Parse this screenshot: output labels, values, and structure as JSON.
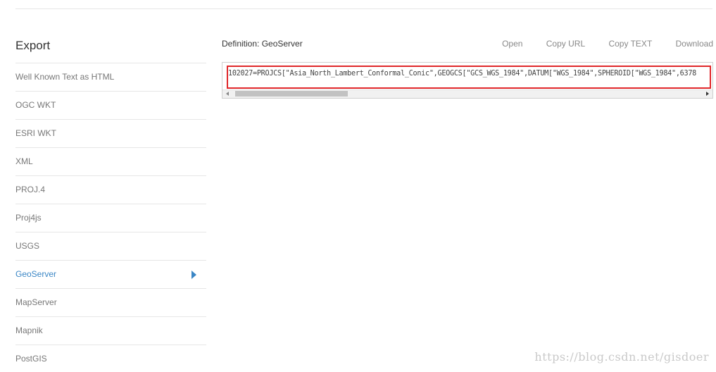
{
  "sidebar": {
    "title": "Export",
    "items": [
      {
        "label": "Well Known Text as HTML"
      },
      {
        "label": "OGC WKT"
      },
      {
        "label": "ESRI WKT"
      },
      {
        "label": "XML"
      },
      {
        "label": "PROJ.4"
      },
      {
        "label": "Proj4js"
      },
      {
        "label": "USGS"
      },
      {
        "label": "GeoServer"
      },
      {
        "label": "MapServer"
      },
      {
        "label": "Mapnik"
      },
      {
        "label": "PostGIS"
      }
    ],
    "active_item": "GeoServer"
  },
  "definition": {
    "label": "Definition: GeoServer",
    "actions": {
      "open": "Open",
      "copy_url": "Copy URL",
      "copy_text": "Copy TEXT",
      "download": "Download"
    },
    "text": "102027=PROJCS[\"Asia_North_Lambert_Conformal_Conic\",GEOGCS[\"GCS_WGS_1984\",DATUM[\"WGS_1984\",SPHEROID[\"WGS_1984\",6378"
  },
  "watermark": "https://blog.csdn.net/gisdoer",
  "colors": {
    "accent": "#3a86c5",
    "highlight": "#e0272a"
  }
}
